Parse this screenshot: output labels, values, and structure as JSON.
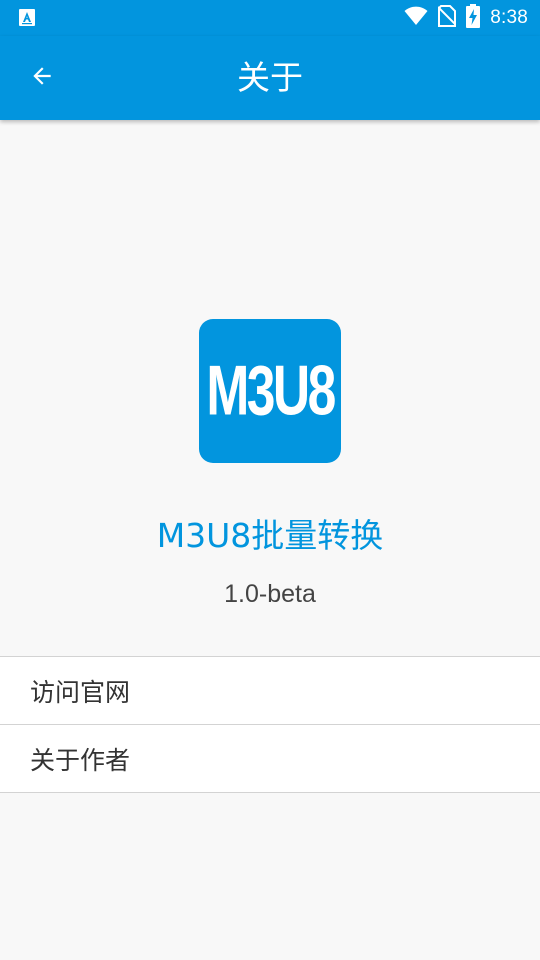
{
  "status_bar": {
    "time": "8:38",
    "left_icon": "android-notification-icon",
    "icons": [
      "wifi-icon",
      "no-sim-icon",
      "battery-charging-icon"
    ]
  },
  "app_bar": {
    "title": "关于",
    "back_icon": "arrow-back-icon"
  },
  "about": {
    "logo_text": "M3U8",
    "app_name": "M3U8批量转换",
    "version": "1.0-beta"
  },
  "menu": {
    "items": [
      {
        "label": "访问官网"
      },
      {
        "label": "关于作者"
      }
    ]
  },
  "colors": {
    "primary": "#0295de",
    "background": "#f8f8f8",
    "divider": "#d3d3d3",
    "text": "#333333"
  }
}
